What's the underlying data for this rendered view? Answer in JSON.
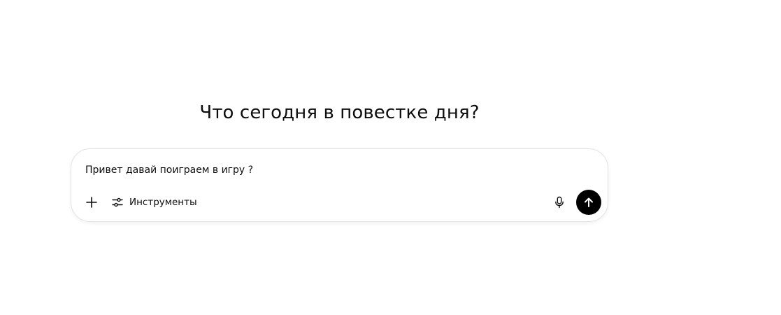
{
  "heading": "Что сегодня в повестке дня?",
  "composer": {
    "prompt_value": "Привет давай поиграем в игру ?",
    "tools_label": "Инструменты"
  },
  "icons": {
    "add": "plus-icon",
    "tools": "sliders-icon",
    "mic": "microphone-icon",
    "send": "arrow-up-icon"
  },
  "colors": {
    "send_button_bg": "#000000",
    "composer_border": "#e3e3e3",
    "text": "#0d0d0d"
  }
}
